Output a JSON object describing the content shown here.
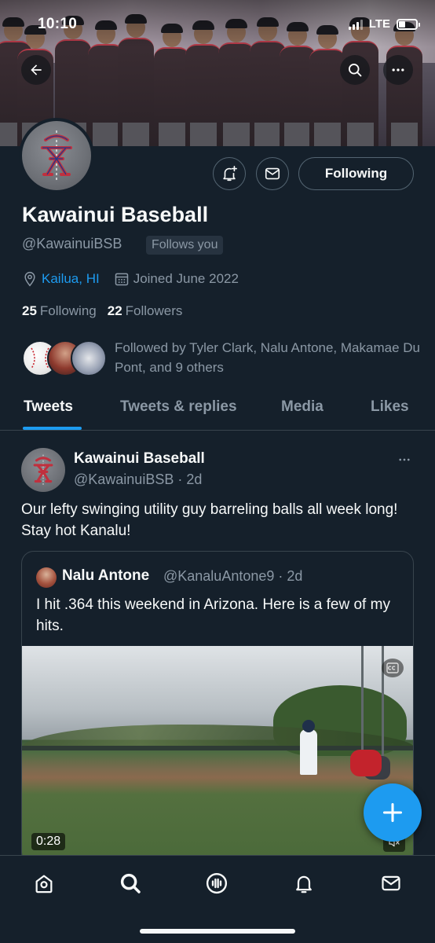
{
  "status_bar": {
    "time": "10:10",
    "network": "LTE"
  },
  "profile": {
    "name": "Kawainui Baseball",
    "handle": "@KawainuiBSB",
    "follows_you": "Follows you",
    "location": "Kailua, HI",
    "joined": "Joined June 2022",
    "following_count": "25",
    "following_label": "Following",
    "followers_count": "22",
    "followers_label": "Followers",
    "followed_by": "Followed by Tyler Clark, Nalu Antone, Makamae Du Pont, and 9 others",
    "follow_button": "Following"
  },
  "tabs": [
    "Tweets",
    "Tweets & replies",
    "Media",
    "Likes"
  ],
  "tweet": {
    "name": "Kawainui Baseball",
    "handle_time": "@KawainuiBSB · 2d",
    "text": "Our lefty swinging utility guy barreling balls all week long! Stay hot Kanalu!",
    "quote": {
      "name": "Nalu Antone",
      "handle_time": "@KanaluAntone9 · 2d",
      "text": "I hit .364 this weekend in Arizona. Here is a few of my hits.",
      "video_duration": "0:28"
    }
  },
  "colors": {
    "background": "#15202b",
    "accent": "#1d9bf0",
    "secondary_text": "#8b98a5"
  },
  "icons": {
    "top": [
      "back-arrow-icon",
      "search-icon",
      "more-icon"
    ],
    "actions": [
      "notification-bell-plus-icon",
      "mail-icon"
    ],
    "nav": [
      "home-icon",
      "search-icon",
      "spaces-icon",
      "notifications-icon",
      "messages-icon"
    ]
  }
}
